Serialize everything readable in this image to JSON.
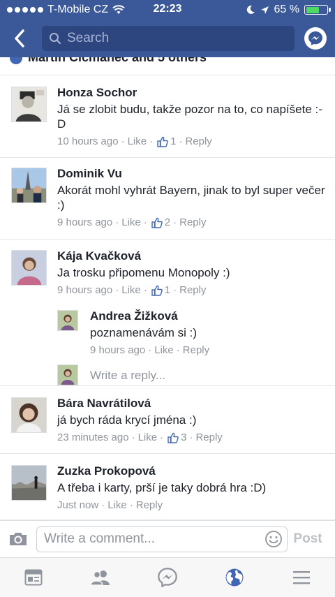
{
  "status": {
    "carrier": "T-Mobile CZ",
    "time": "22:23",
    "battery_percent": "65 %",
    "battery_level": 0.65
  },
  "header": {
    "search_placeholder": "Search"
  },
  "partial_row": {
    "text": "Martin Cicmanec and 5 others"
  },
  "comments": [
    {
      "name": "Honza Sochor",
      "text": "Já se zlobit budu, takže pozor na to, co napíšete :-D",
      "time": "10 hours ago",
      "like": "Like",
      "likes": "1",
      "reply": "Reply"
    },
    {
      "name": "Dominik Vu",
      "text": "Akorát mohl vyhrát Bayern, jinak to byl super večer :)",
      "time": "9 hours ago",
      "like": "Like",
      "likes": "2",
      "reply": "Reply"
    },
    {
      "name": "Kája Kvačková",
      "text": "Ja trosku připomenu Monopoly :)",
      "time": "9 hours ago",
      "like": "Like",
      "likes": "1",
      "reply": "Reply",
      "replies": [
        {
          "name": "Andrea Žižková",
          "text": "poznamenávám si :)",
          "time": "9 hours ago",
          "like": "Like",
          "reply": "Reply"
        }
      ],
      "write_reply": "Write a reply..."
    },
    {
      "name": "Bára Navrátilová",
      "text": "já bych ráda krycí jména :)",
      "time": "23 minutes ago",
      "like": "Like",
      "likes": "3",
      "reply": "Reply"
    },
    {
      "name": "Zuzka Prokopová",
      "text": "A třeba i karty, prší je taky dobrá hra :D)",
      "time": "Just now",
      "like": "Like",
      "reply": "Reply"
    }
  ],
  "composer": {
    "placeholder": "Write a comment...",
    "post_label": "Post"
  },
  "tabbar": {
    "items": [
      "news-feed-icon",
      "friends-icon",
      "messenger-icon",
      "globe-icon",
      "menu-icon"
    ],
    "active": "globe-icon"
  },
  "colors": {
    "brand": "#3b5998",
    "meta": "#90949c",
    "active_tab": "#4267b2"
  }
}
